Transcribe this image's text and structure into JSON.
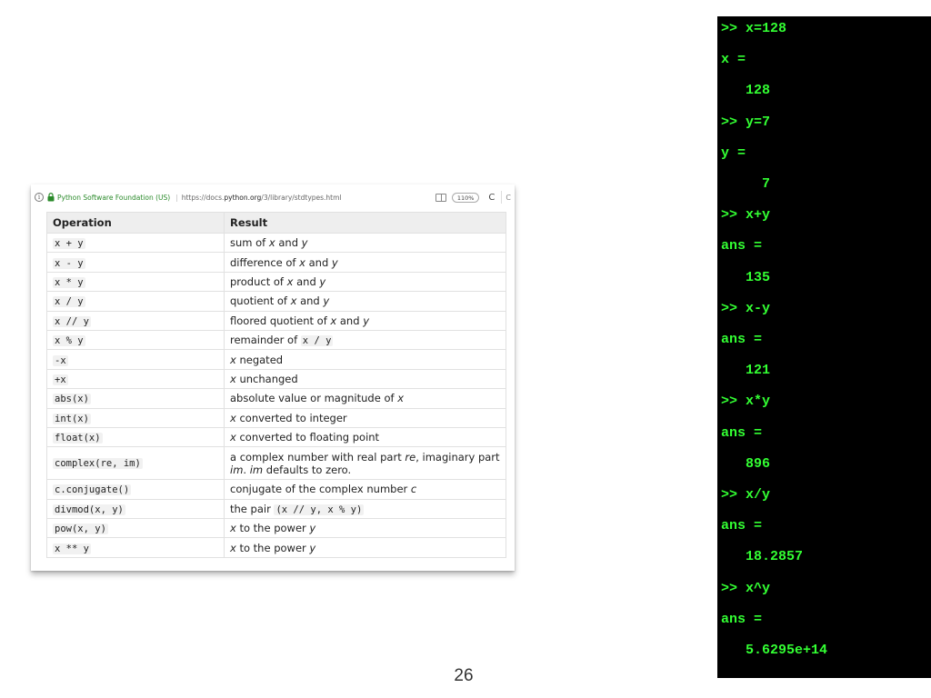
{
  "browser": {
    "info_glyph": "i",
    "site_name": "Python Software Foundation (US)",
    "separator": "|",
    "url_prefix": "https://docs.",
    "url_host": "python.org",
    "url_path": "/3/library/stdtypes.html",
    "zoom": "110%",
    "reload_glyph": "C",
    "next_tab_glyph": "C"
  },
  "table": {
    "headers": [
      "Operation",
      "Result"
    ],
    "rows": [
      {
        "op": "x + y",
        "res": [
          {
            "t": "sum of "
          },
          {
            "t": "x",
            "i": true
          },
          {
            "t": " and "
          },
          {
            "t": "y",
            "i": true
          }
        ]
      },
      {
        "op": "x - y",
        "res": [
          {
            "t": "difference of "
          },
          {
            "t": "x",
            "i": true
          },
          {
            "t": " and "
          },
          {
            "t": "y",
            "i": true
          }
        ]
      },
      {
        "op": "x * y",
        "res": [
          {
            "t": "product of "
          },
          {
            "t": "x",
            "i": true
          },
          {
            "t": " and "
          },
          {
            "t": "y",
            "i": true
          }
        ]
      },
      {
        "op": "x / y",
        "res": [
          {
            "t": "quotient of "
          },
          {
            "t": "x",
            "i": true
          },
          {
            "t": " and "
          },
          {
            "t": "y",
            "i": true
          }
        ]
      },
      {
        "op": "x // y",
        "res": [
          {
            "t": "floored quotient of "
          },
          {
            "t": "x",
            "i": true
          },
          {
            "t": " and "
          },
          {
            "t": "y",
            "i": true
          }
        ]
      },
      {
        "op": "x % y",
        "res": [
          {
            "t": "remainder of "
          },
          {
            "t": "x / y",
            "c": true
          }
        ]
      },
      {
        "op": "-x",
        "res": [
          {
            "t": "x",
            "i": true
          },
          {
            "t": " negated"
          }
        ]
      },
      {
        "op": "+x",
        "res": [
          {
            "t": "x",
            "i": true
          },
          {
            "t": " unchanged"
          }
        ]
      },
      {
        "op": "abs(x)",
        "res": [
          {
            "t": "absolute value or magnitude of "
          },
          {
            "t": "x",
            "i": true
          }
        ]
      },
      {
        "op": "int(x)",
        "res": [
          {
            "t": "x",
            "i": true
          },
          {
            "t": " converted to integer"
          }
        ]
      },
      {
        "op": "float(x)",
        "res": [
          {
            "t": "x",
            "i": true
          },
          {
            "t": " converted to floating point"
          }
        ]
      },
      {
        "op": "complex(re, im)",
        "tall": true,
        "res": [
          {
            "t": "a complex number with real part "
          },
          {
            "t": "re",
            "i": true
          },
          {
            "t": ", imaginary part "
          },
          {
            "t": "im",
            "i": true
          },
          {
            "t": ". "
          },
          {
            "t": "im",
            "i": true
          },
          {
            "t": " defaults to zero."
          }
        ]
      },
      {
        "op": "c.conjugate()",
        "res": [
          {
            "t": "conjugate of the complex number "
          },
          {
            "t": "c",
            "i": true
          }
        ]
      },
      {
        "op": "divmod(x, y)",
        "res": [
          {
            "t": "the pair "
          },
          {
            "t": "(x // y, x % y)",
            "c": true
          }
        ]
      },
      {
        "op": "pow(x, y)",
        "res": [
          {
            "t": "x",
            "i": true
          },
          {
            "t": " to the power "
          },
          {
            "t": "y",
            "i": true
          }
        ]
      },
      {
        "op": "x ** y",
        "res": [
          {
            "t": "x",
            "i": true
          },
          {
            "t": " to the power "
          },
          {
            "t": "y",
            "i": true
          }
        ]
      }
    ]
  },
  "page_number": "26",
  "terminal": {
    "lines": [
      ">> x=128",
      "x =",
      "   128",
      ">> y=7",
      "y =",
      "     7",
      ">> x+y",
      "ans =",
      "   135",
      ">> x-y",
      "ans =",
      "   121",
      ">> x*y",
      "ans =",
      "   896",
      ">> x/y",
      "ans =",
      "   18.2857",
      ">> x^y",
      "ans =",
      "   5.6295e+14"
    ]
  }
}
